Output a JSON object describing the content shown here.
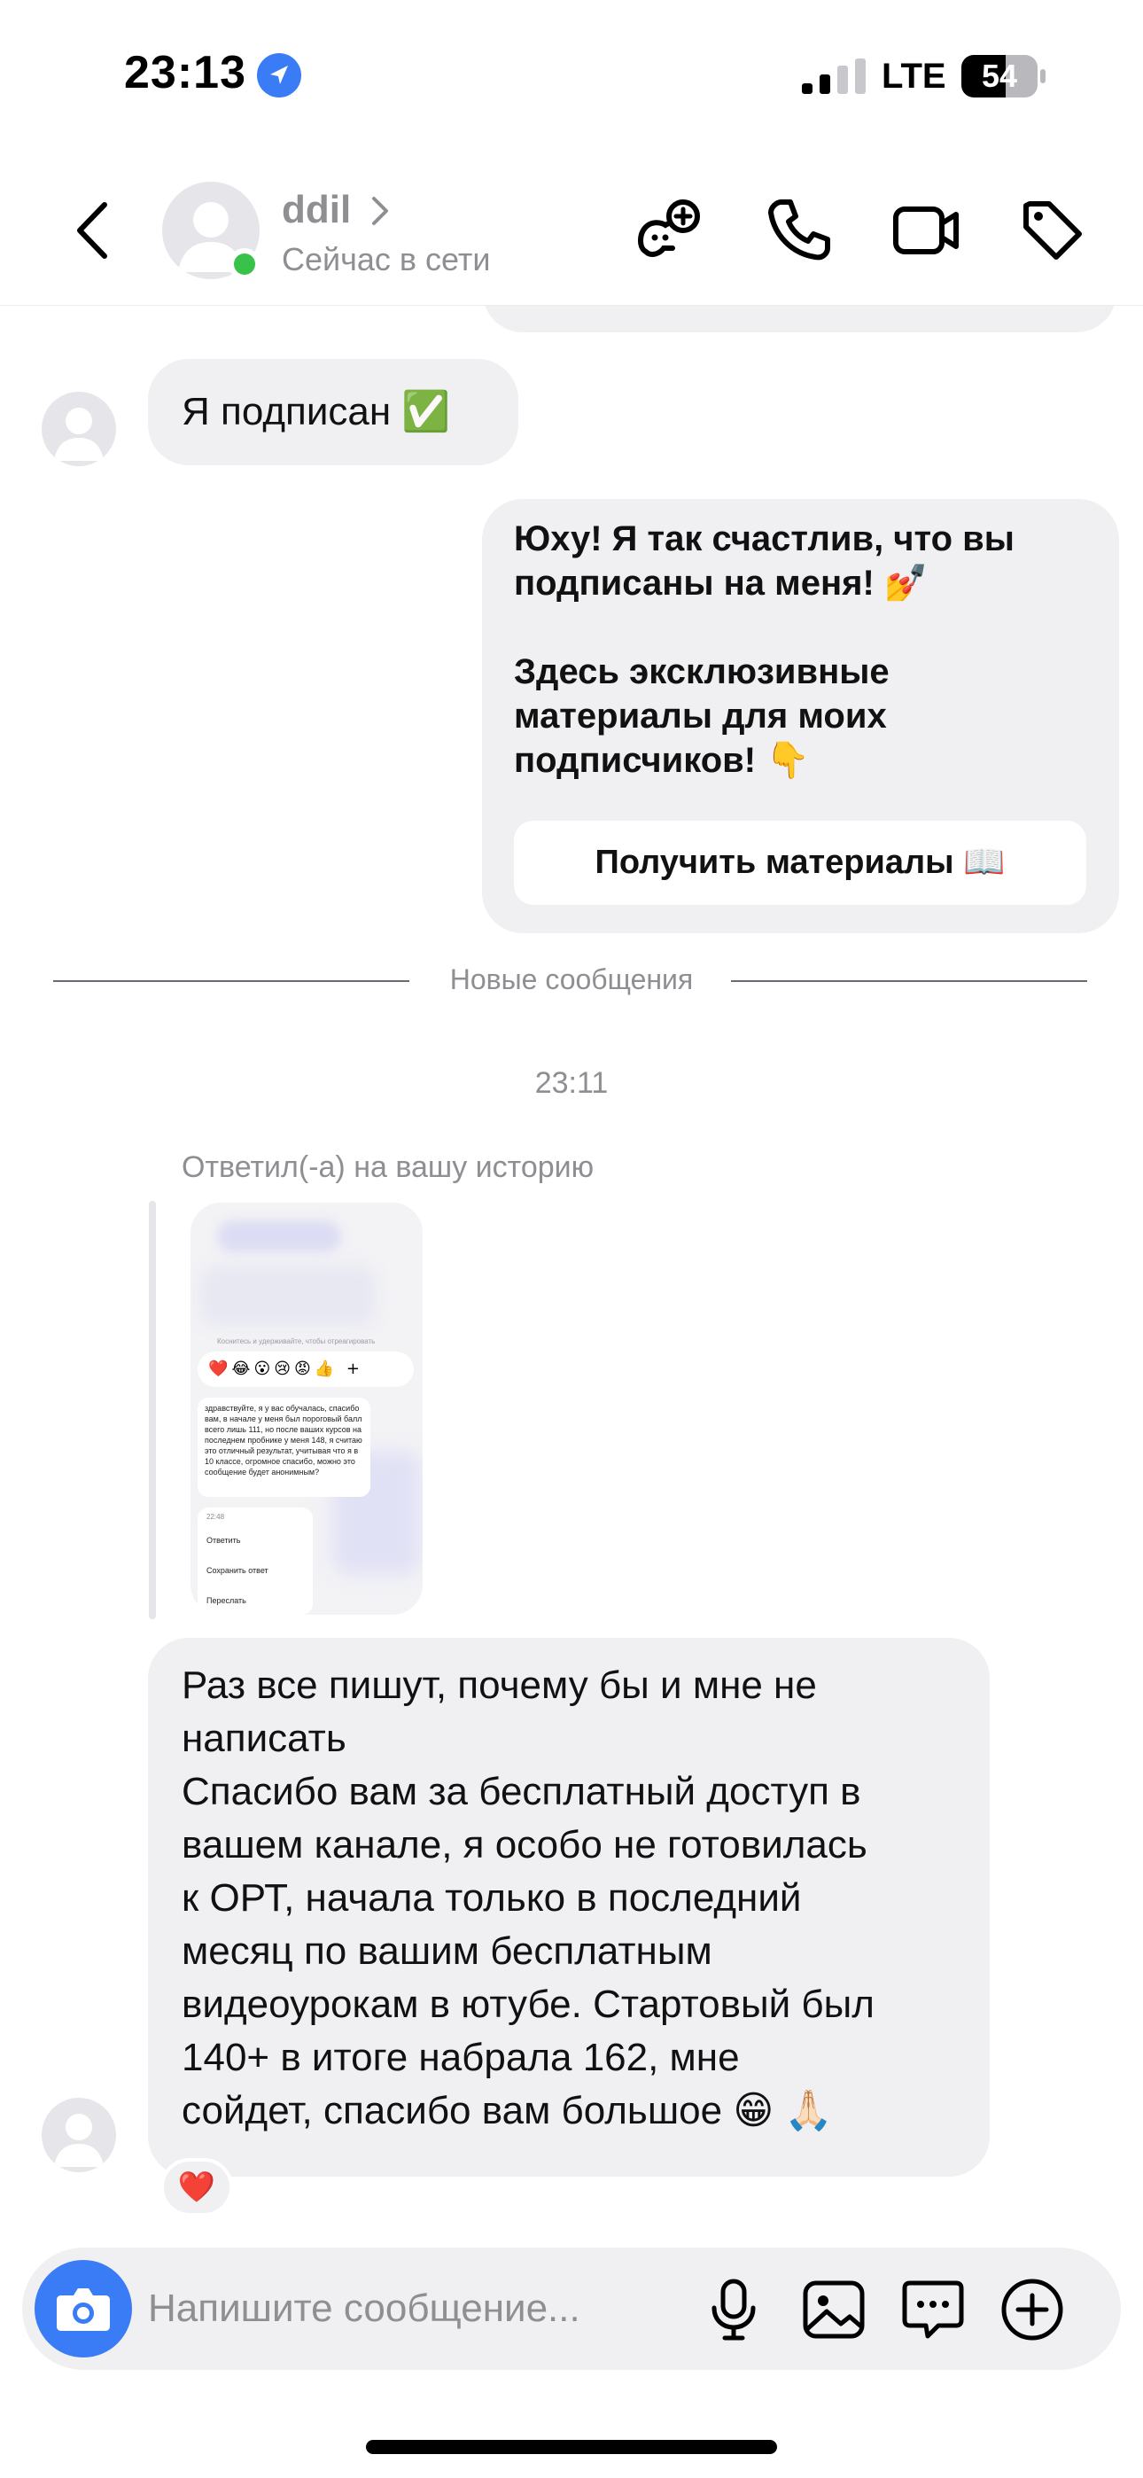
{
  "status_bar": {
    "time": "23:13",
    "network": "LTE",
    "battery": "54"
  },
  "header": {
    "name": "ddil",
    "status": "Сейчас в сети"
  },
  "messages": {
    "m1": {
      "text": "Я подписан ✅"
    },
    "m2": {
      "line1": "Юху! Я так счастлив, что вы",
      "line2": "подписаны на меня! 💅",
      "line3": "Здесь эксклюзивные",
      "line4": "материалы для моих",
      "line5": "подписчиков! 👇",
      "button": "Получить материалы 📖"
    },
    "divider": "Новые сообщения",
    "timestamp": "23:11",
    "reply_label": "Ответил(-а) на вашу историю",
    "story": {
      "hint": "Коснитесь и удерживайте, чтобы отреагировать",
      "reactions": "❤️😂😮😢😡👍 +",
      "message": "здравствуйте, я у вас обучалась, спасибо вам, в начале у меня был пороговый балл всего лишь 111, но после ваших курсов на последнем пробнике у меня 148, я считаю это отличный результат, учитывая что я в 10 классе, огромное спасибо, можно это сообщение будет анонимным?",
      "menu_time": "22:48",
      "menu_reply": "Ответить",
      "menu_save": "Сохранить ответ",
      "menu_forward": "Переслать"
    },
    "m3": {
      "line1": "Раз все пишут, почему бы и мне не",
      "line2": "написать",
      "line3": "Спасибо вам за бесплатный доступ в",
      "line4": "вашем канале, я особо не готовилась",
      "line5": "к ОРТ, начала только в последний",
      "line6": "месяц по вашим  бесплатным",
      "line7": "видеоурокам в ютубе. Стартовый был",
      "line8": "140+ в итоге набрала 162, мне",
      "line9": "сойдет, спасибо вам большое 😁 🙏🏻"
    },
    "reaction": "❤️"
  },
  "composer": {
    "placeholder": "Напишите сообщение..."
  },
  "colors": {
    "accent": "#3a7cf5",
    "online": "#39c24a",
    "bubble": "#f0f0f3",
    "muted": "#8e8e93"
  },
  "icons": [
    "location-arrow-icon",
    "signal-icon",
    "battery-icon",
    "back-chevron-icon",
    "chevron-right-icon",
    "game-controller-add-icon",
    "phone-icon",
    "video-camera-icon",
    "tag-icon",
    "camera-icon",
    "microphone-icon",
    "image-icon",
    "sticker-chat-icon",
    "add-circle-icon"
  ]
}
